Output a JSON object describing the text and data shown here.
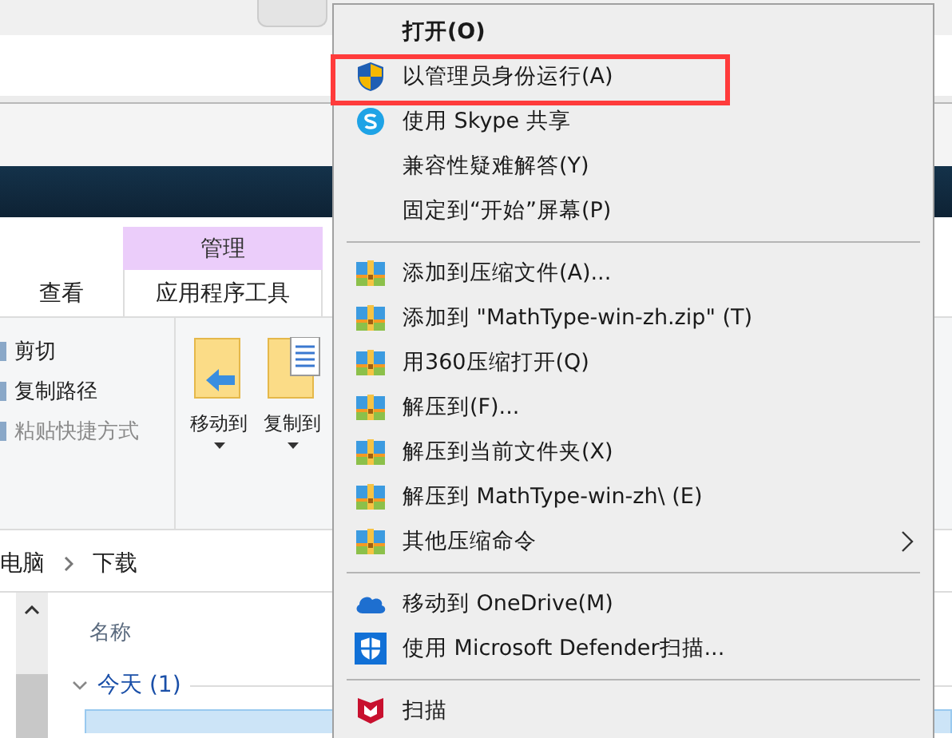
{
  "ribbon": {
    "context_tab": "管理",
    "tabs": [
      {
        "label": "查看",
        "selected": false
      },
      {
        "label": "应用程序工具",
        "selected": true
      }
    ],
    "clipboard": [
      {
        "label": "剪切",
        "disabled": false
      },
      {
        "label": "复制路径",
        "disabled": false
      },
      {
        "label": "粘贴快捷方式",
        "disabled": true
      }
    ],
    "organize": [
      {
        "label": "移动到",
        "kind": "move"
      },
      {
        "label": "复制到",
        "kind": "copy"
      }
    ]
  },
  "breadcrumb": [
    "电脑",
    "下载"
  ],
  "file_list": {
    "column": "名称",
    "group": "今天 (1)"
  },
  "context_menu": [
    {
      "kind": "item",
      "label": "打开(O)",
      "bold": true,
      "highlighted": false
    },
    {
      "kind": "item",
      "label": "以管理员身份运行(A)",
      "bold": false,
      "highlighted": true
    },
    {
      "kind": "item",
      "label": "使用 Skype 共享",
      "bold": false,
      "highlighted": false
    },
    {
      "kind": "item",
      "label": "兼容性疑难解答(Y)",
      "bold": false,
      "highlighted": false
    },
    {
      "kind": "item",
      "label": "固定到“开始”屏幕(P)",
      "bold": false,
      "highlighted": false
    },
    {
      "kind": "separator"
    },
    {
      "kind": "item",
      "label": "添加到压缩文件(A)...",
      "bold": false,
      "highlighted": false
    },
    {
      "kind": "item",
      "label": "添加到 \"MathType-win-zh.zip\" (T)",
      "bold": false,
      "highlighted": false
    },
    {
      "kind": "item",
      "label": "用360压缩打开(Q)",
      "bold": false,
      "highlighted": false
    },
    {
      "kind": "item",
      "label": "解压到(F)...",
      "bold": false,
      "highlighted": false
    },
    {
      "kind": "item",
      "label": "解压到当前文件夹(X)",
      "bold": false,
      "highlighted": false
    },
    {
      "kind": "item",
      "label": "解压到 MathType-win-zh\\ (E)",
      "bold": false,
      "highlighted": false
    },
    {
      "kind": "submenu",
      "label": "其他压缩命令",
      "bold": false,
      "highlighted": false
    },
    {
      "kind": "separator"
    },
    {
      "kind": "item",
      "label": "移动到 OneDrive(M)",
      "bold": false,
      "highlighted": false
    },
    {
      "kind": "item",
      "label": "使用 Microsoft Defender扫描...",
      "bold": false,
      "highlighted": false
    },
    {
      "kind": "separator"
    },
    {
      "kind": "item",
      "label": "扫描",
      "bold": false,
      "highlighted": false
    }
  ]
}
